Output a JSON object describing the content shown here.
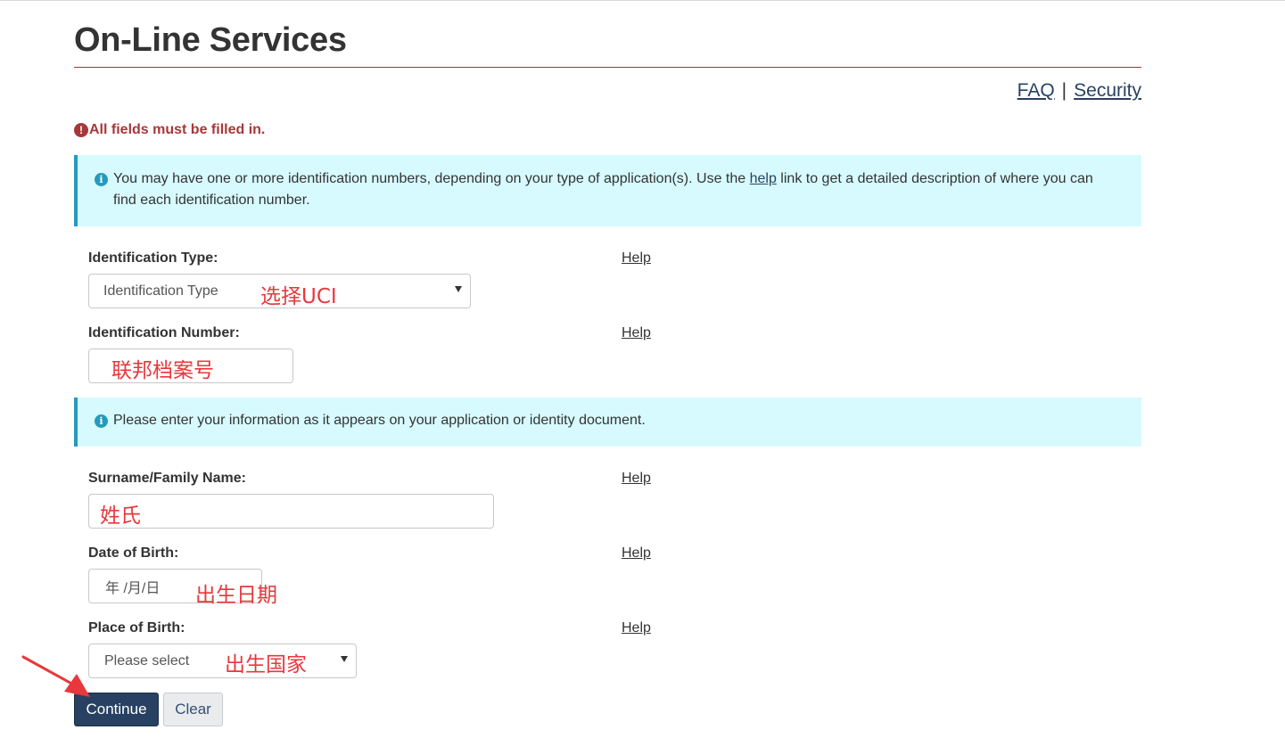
{
  "header": {
    "title": "On-Line Services",
    "links": {
      "faq": "FAQ",
      "separator": "|",
      "security": "Security"
    }
  },
  "error_message": "All fields must be filled in.",
  "info_alerts": [
    {
      "before": "You may have one or more identification numbers, depending on your type of application(s). Use the ",
      "link": "help",
      "after": " link to get a detailed description of where you can find each identification number."
    },
    {
      "text": "Please enter your information as it appears on your application or identity document."
    }
  ],
  "form": {
    "help_label": "Help",
    "identification_type": {
      "label": "Identification Type:",
      "selected": "Identification Type",
      "annotation": "选择UCI"
    },
    "identification_number": {
      "label": "Identification Number:",
      "value": "",
      "annotation": "联邦档案号"
    },
    "surname": {
      "label": "Surname/Family Name:",
      "value": "",
      "annotation": "姓氏"
    },
    "date_of_birth": {
      "label": "Date of Birth:",
      "placeholder": "年 /月/日",
      "annotation": "出生日期"
    },
    "place_of_birth": {
      "label": "Place of Birth:",
      "selected": "Please select",
      "annotation": "出生国家"
    }
  },
  "buttons": {
    "continue": "Continue",
    "clear": "Clear"
  },
  "colors": {
    "title_rule": "#a0383b",
    "error": "#a8373a",
    "alert_bg": "#d7faff",
    "alert_border": "#269abc",
    "primary_button": "#284162",
    "annotation": "#e8383d"
  }
}
